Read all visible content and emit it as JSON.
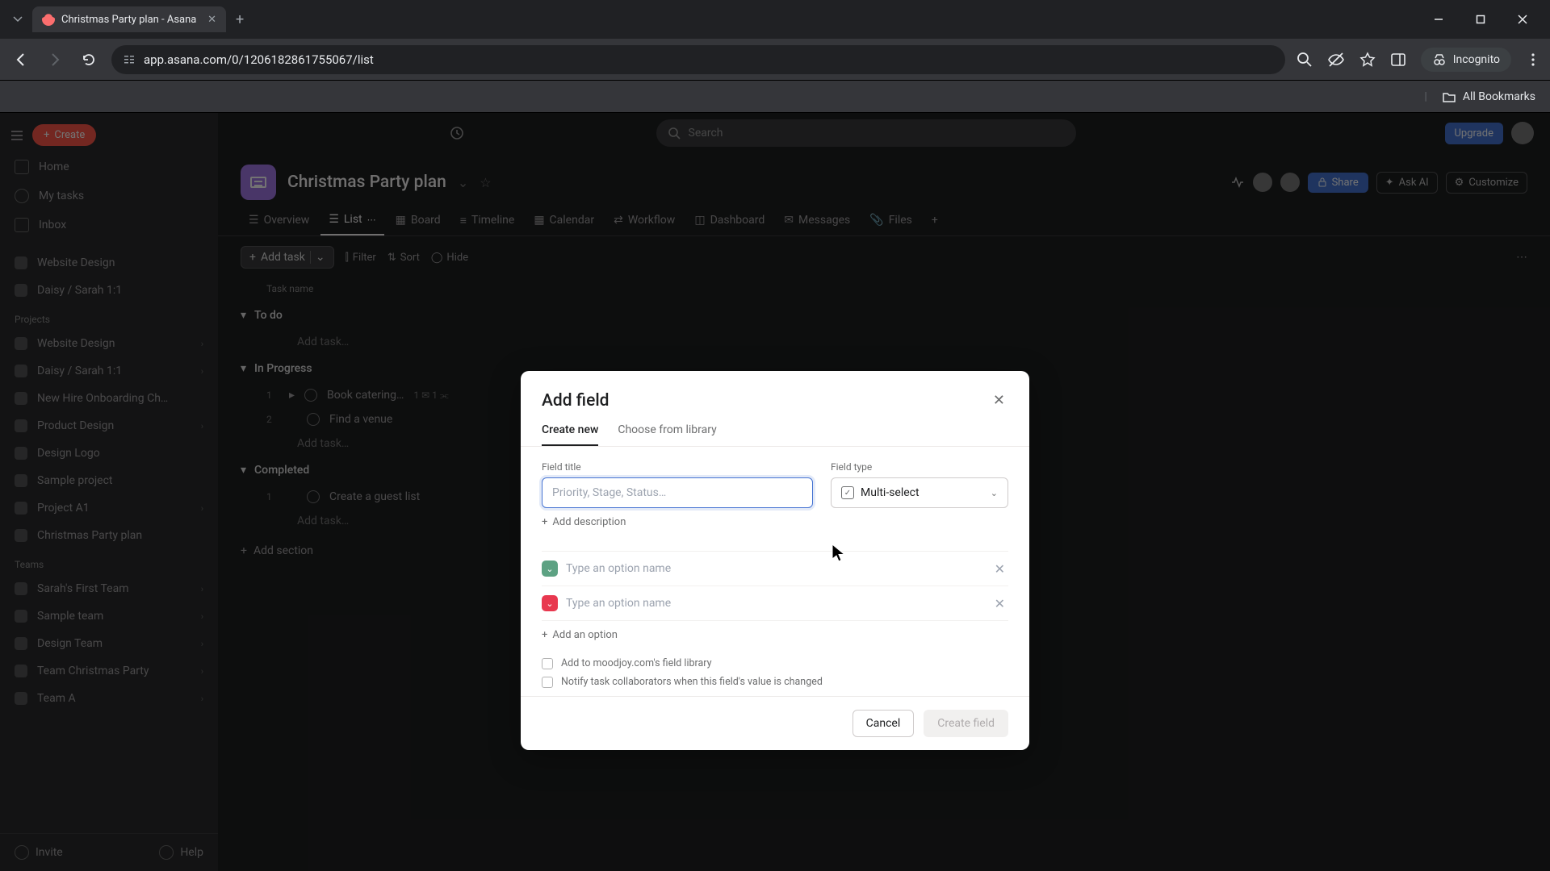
{
  "browser": {
    "tab_title": "Christmas Party plan - Asana",
    "url": "app.asana.com/0/1206182861755067/list",
    "incognito": "Incognito",
    "all_bookmarks": "All Bookmarks"
  },
  "sidebar": {
    "create": "Create",
    "home": "Home",
    "my_tasks": "My tasks",
    "inbox": "Inbox",
    "fav_label_1": "Website Design",
    "fav_label_2": "Daisy / Sarah 1:1",
    "projects_header": "Projects",
    "projects": [
      "Website Design",
      "Daisy / Sarah 1:1",
      "New Hire Onboarding Ch…",
      "Product Design",
      "Design Logo",
      "Sample project",
      "Project A1",
      "Christmas Party plan"
    ],
    "teams_header": "Teams",
    "teams": [
      "Sarah's First Team",
      "Sample team",
      "Design Team",
      "Team Christmas Party",
      "Team A"
    ],
    "invite": "Invite",
    "help": "Help"
  },
  "topbar": {
    "search_placeholder": "Search",
    "upgrade": "Upgrade"
  },
  "project": {
    "title": "Christmas Party plan",
    "share": "Share",
    "ask_ai": "Ask AI",
    "customize": "Customize",
    "tabs": {
      "overview": "Overview",
      "list": "List",
      "board": "Board",
      "timeline": "Timeline",
      "calendar": "Calendar",
      "workflow": "Workflow",
      "dashboard": "Dashboard",
      "messages": "Messages",
      "files": "Files"
    },
    "toolbar": {
      "add_task": "Add task",
      "filter": "Filter",
      "sort": "Sort",
      "hide": "Hide"
    },
    "col_task_name": "Task name",
    "sections": {
      "todo": "To do",
      "in_progress": "In Progress",
      "completed": "Completed"
    },
    "tasks": {
      "book_catering": "Book catering…",
      "find_venue": "Find a venue",
      "create_guest": "Create a guest list"
    },
    "add_task_ghost": "Add task…",
    "add_section": "Add section"
  },
  "modal": {
    "title": "Add field",
    "tab_create": "Create new",
    "tab_library": "Choose from library",
    "field_title_label": "Field title",
    "field_title_placeholder": "Priority, Stage, Status…",
    "field_type_label": "Field type",
    "field_type_value": "Multi-select",
    "add_description": "Add description",
    "option_placeholder": "Type an option name",
    "add_option": "Add an option",
    "check_library": "Add to moodjoy.com's field library",
    "check_notify": "Notify task collaborators when this field's value is changed",
    "cancel": "Cancel",
    "create_field": "Create field"
  }
}
